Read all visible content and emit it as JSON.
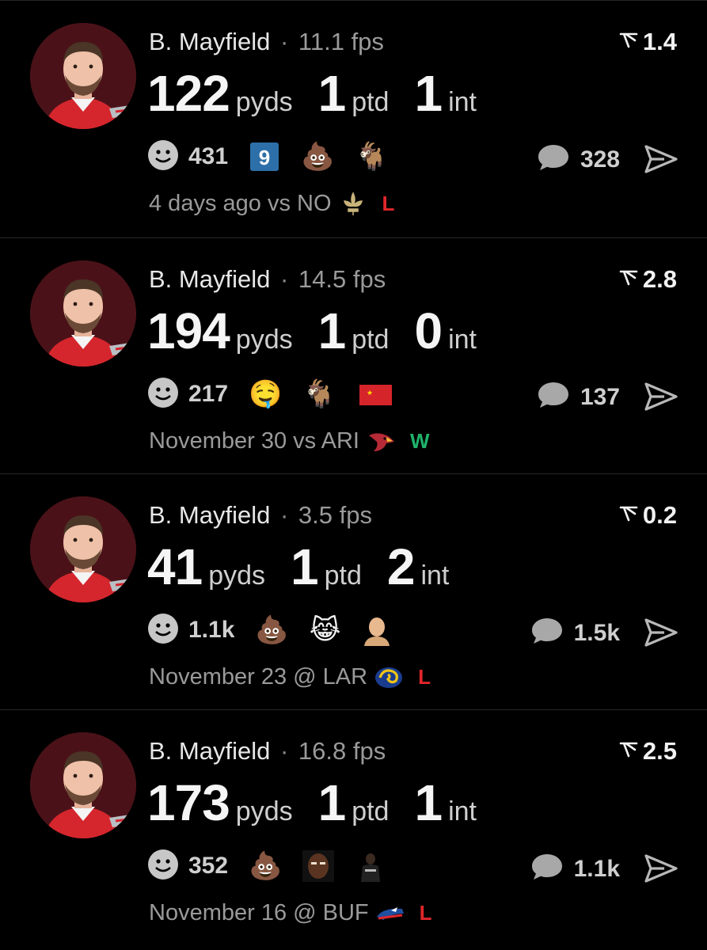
{
  "colors": {
    "background": "#000000",
    "loss": "#e0262b",
    "win": "#1fb36a",
    "muted": "#9a9a9a",
    "avatar_bg": "#4a1218"
  },
  "posts": [
    {
      "player": "B. Mayfield",
      "separator": "·",
      "fps": "11.1 fps",
      "rating": "1.4",
      "stats": [
        {
          "value": "122",
          "unit": "pyds"
        },
        {
          "value": "1",
          "unit": "ptd"
        },
        {
          "value": "1",
          "unit": "int"
        }
      ],
      "reaction_count": "431",
      "reactions": [
        "number-9-badge",
        "pile-of-poo-emoji",
        "goat-emoji"
      ],
      "comments": "328",
      "game": "4 days ago vs NO",
      "opponent_logo": "saints-fleur-de-lis-logo",
      "result": "L"
    },
    {
      "player": "B. Mayfield",
      "separator": "·",
      "fps": "14.5 fps",
      "rating": "2.8",
      "stats": [
        {
          "value": "194",
          "unit": "pyds"
        },
        {
          "value": "1",
          "unit": "ptd"
        },
        {
          "value": "0",
          "unit": "int"
        }
      ],
      "reaction_count": "217",
      "reactions": [
        "drooling-face-emoji",
        "goat-emoji",
        "china-flag-emoji"
      ],
      "comments": "137",
      "game": "November 30 vs ARI",
      "opponent_logo": "cardinals-logo",
      "result": "W"
    },
    {
      "player": "B. Mayfield",
      "separator": "·",
      "fps": "3.5 fps",
      "rating": "0.2",
      "stats": [
        {
          "value": "41",
          "unit": "pyds"
        },
        {
          "value": "1",
          "unit": "ptd"
        },
        {
          "value": "2",
          "unit": "int"
        }
      ],
      "reaction_count": "1.1k",
      "reactions": [
        "pile-of-poo-emoji",
        "cat-tears-of-joy-emoji",
        "bald-man-sticker"
      ],
      "comments": "1.5k",
      "game": "November 23 @ LAR",
      "opponent_logo": "rams-logo",
      "result": "L"
    },
    {
      "player": "B. Mayfield",
      "separator": "·",
      "fps": "16.8 fps",
      "rating": "2.5",
      "stats": [
        {
          "value": "173",
          "unit": "pyds"
        },
        {
          "value": "1",
          "unit": "ptd"
        },
        {
          "value": "1",
          "unit": "int"
        }
      ],
      "reaction_count": "352",
      "reactions": [
        "pile-of-poo-emoji",
        "face-photo-sticker",
        "nets-player-sticker"
      ],
      "comments": "1.1k",
      "game": "November 16 @ BUF",
      "opponent_logo": "bills-logo",
      "result": "L"
    }
  ]
}
